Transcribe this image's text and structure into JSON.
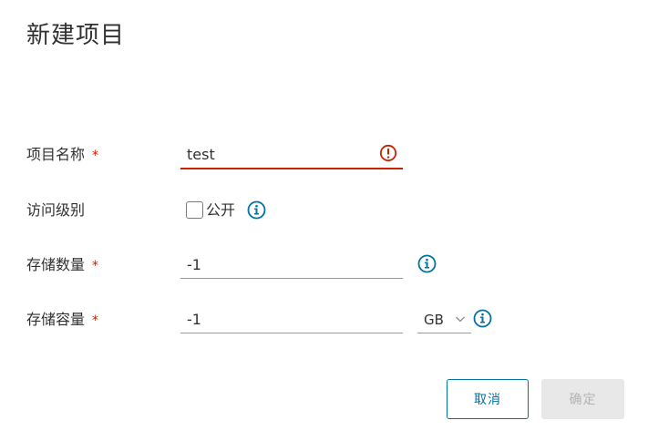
{
  "dialog": {
    "title": "新建项目"
  },
  "form": {
    "project_name": {
      "label": "项目名称",
      "required_mark": "*",
      "value": "test"
    },
    "access_level": {
      "label": "访问级别",
      "checkbox_label": "公开",
      "checked": false
    },
    "storage_count": {
      "label": "存储数量",
      "required_mark": "*",
      "value": "-1"
    },
    "storage_capacity": {
      "label": "存储容量",
      "required_mark": "*",
      "value": "-1",
      "unit": "GB"
    }
  },
  "buttons": {
    "cancel": "取消",
    "confirm": "确定"
  },
  "colors": {
    "error": "#c92100",
    "accent": "#0072a3",
    "disabled_bg": "#e8e8e8",
    "disabled_text": "#b3b3b3"
  }
}
